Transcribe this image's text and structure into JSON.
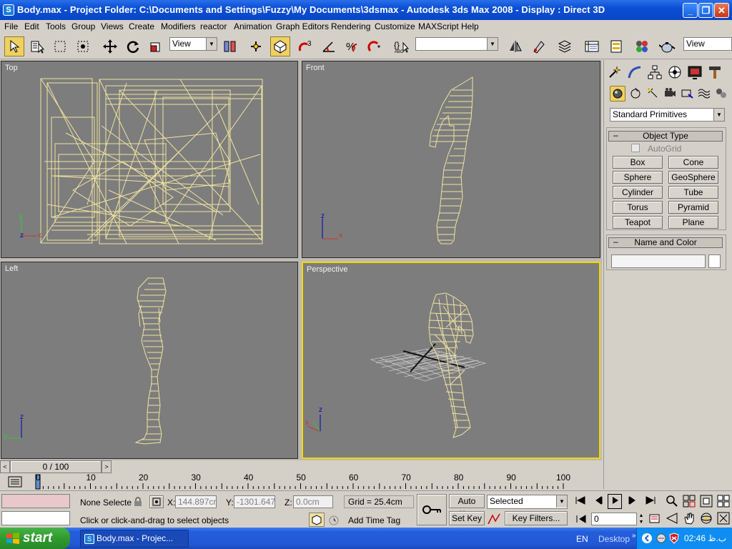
{
  "window": {
    "title": "Body.max      - Project Folder: C:\\Documents and Settings\\Fuzzy\\My Documents\\3dsmax      - Autodesk 3ds Max 2008      - Display : Direct 3D",
    "app_icon": "3dsmax-icon",
    "controls": [
      "minimize",
      "maximize",
      "close"
    ]
  },
  "menu": [
    "File",
    "Edit",
    "Tools",
    "Group",
    "Views",
    "Create",
    "Modifiers",
    "reactor",
    "Animation",
    "Graph Editors",
    "Rendering",
    "Customize",
    "MAXScript",
    "Help"
  ],
  "toolbar": {
    "ref_coord": "View",
    "named_selection": "",
    "view_dropdown2": "View"
  },
  "viewports": [
    {
      "label": "Top"
    },
    {
      "label": "Front"
    },
    {
      "label": "Left"
    },
    {
      "label": "Perspective"
    }
  ],
  "command_panel": {
    "category": "Standard Primitives",
    "object_type_title": "Object Type",
    "autogrid": "AutoGrid",
    "buttons": [
      "Box",
      "Cone",
      "Sphere",
      "GeoSphere",
      "Cylinder",
      "Tube",
      "Torus",
      "Pyramid",
      "Teapot",
      "Plane"
    ],
    "name_color_title": "Name and Color",
    "name_value": ""
  },
  "time_slider": {
    "label": "0 / 100",
    "current": 0,
    "max": 100
  },
  "ruler": {
    "ticks": [
      0,
      10,
      20,
      30,
      40,
      50,
      60,
      70,
      80,
      90,
      100
    ]
  },
  "status": {
    "selection": "None Selecte",
    "x_label": "X:",
    "x_value": "144.897cm",
    "y_label": "Y:",
    "y_value": "-1301.647c",
    "z_label": "Z:",
    "z_value": "0.0cm",
    "grid": "Grid = 25.4cm",
    "prompt": "Click or click-and-drag to select objects",
    "add_time_tag": "Add Time Tag",
    "auto_key": "Auto Key",
    "set_key": "Set Key",
    "key_mode": "Selected",
    "key_filters": "Key Filters...",
    "frame": "0"
  },
  "taskbar": {
    "start": "start",
    "task_item": "Body.max      - Projec...",
    "lang": "EN",
    "desktop": "Desktop",
    "clock": "02:46 ب.ظ"
  },
  "colors": {
    "wire": "#efe3a0",
    "viewport_bg": "#7d7d7d",
    "active_border": "#f0d800"
  }
}
